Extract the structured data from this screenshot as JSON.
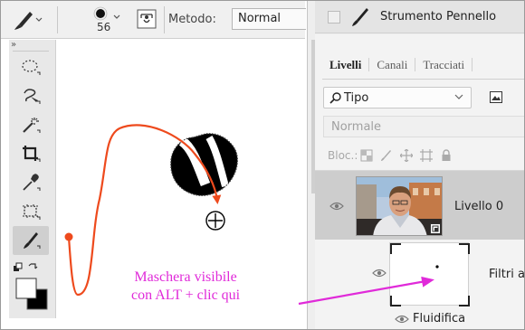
{
  "options_bar": {
    "brush_size": "56",
    "mode_label": "Metodo:",
    "mode_value": "Normal"
  },
  "toolbar": {
    "collapse_glyph": "»",
    "tools": [
      "elliptical-marquee-icon",
      "lasso-icon",
      "magic-wand-icon",
      "crop-icon",
      "eyedropper-icon",
      "frame-icon",
      "brush-icon"
    ],
    "active_tool": "brush-icon",
    "foreground_color": "#ffffff",
    "background_color": "#000000"
  },
  "brush_panel": {
    "title": "Strumento Pennello"
  },
  "layers_panel": {
    "tabs": [
      {
        "label": "Livelli",
        "active": true
      },
      {
        "label": "Canali",
        "active": false
      },
      {
        "label": "Tracciati",
        "active": false
      }
    ],
    "filter_kind": "Tipo",
    "blend_mode": "Normale",
    "lock_label": "Bloc.:",
    "layers": [
      {
        "name": "Livello 0",
        "selected": true
      },
      {
        "name": "Filtri a",
        "selected": false
      },
      {
        "name": "Fluidifica",
        "selected": false
      }
    ]
  },
  "annotation": {
    "line1": "Maschera visibile",
    "line2": "con ALT + clic qui",
    "color": "#e02ad9",
    "path_color": "#ee4a1d"
  }
}
